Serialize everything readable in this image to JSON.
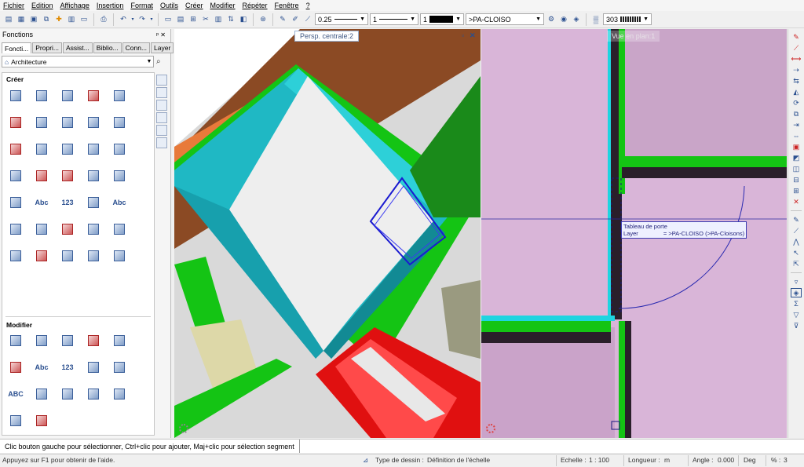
{
  "menu": [
    "Fichier",
    "Edition",
    "Affichage",
    "Insertion",
    "Format",
    "Outils",
    "Créer",
    "Modifier",
    "Répéter",
    "Fenêtre",
    "?"
  ],
  "toolbar": {
    "pen_thickness": "0.25",
    "line_type": "1",
    "color_number": "1",
    "layer": ">PA-CLOISO",
    "style_number": "303"
  },
  "panel": {
    "title": "Fonctions",
    "pin": "ᵖ ✕",
    "tabs": [
      "Foncti...",
      "Propri...",
      "Assist...",
      "Biblio...",
      "Conn...",
      "Layer"
    ],
    "library": "Architecture",
    "section_create": "Créer",
    "section_modify": "Modifier",
    "create_icon_labels": [
      "",
      "",
      "",
      "",
      "",
      "",
      "",
      "",
      "",
      "",
      "",
      "",
      "",
      "",
      "",
      "",
      "",
      "",
      "",
      "",
      "",
      "Abc",
      "123",
      "",
      "Abc",
      "",
      "",
      "",
      "",
      "",
      "",
      "",
      "",
      "",
      ""
    ],
    "modify_icon_labels": [
      "",
      "",
      "",
      "",
      "",
      "",
      "Abc",
      "123",
      "",
      "",
      "ABC",
      "",
      "",
      "",
      "",
      "",
      ""
    ]
  },
  "viewports": {
    "perspective_title": "Persp. centrale:2",
    "plan_title": "Vue en plan:1",
    "tooltip_line1": "Tableau de porte",
    "tooltip_line2_label": "Layer",
    "tooltip_line2_value": "= >PA-CLOISO (>PA-Cloisons)"
  },
  "hint": "Clic bouton gauche pour sélectionner, Ctrl+clic pour ajouter, Maj+clic pour sélection segment",
  "status": {
    "help": "Appuyez sur F1 pour obtenir de l'aide.",
    "drawing_type_label": "Type de dessin :",
    "drawing_type_value": "Définition de l'échelle",
    "scale_label": "Echelle :",
    "scale_value": "1 : 100",
    "length_label": "Longueur :",
    "length_value": "m",
    "angle_label": "Angle :",
    "angle_value": "0.000",
    "angle_unit": "Deg",
    "percent_label": "% :",
    "percent_value": "3"
  },
  "colors": {
    "wall_cyan": "#1fb8c4",
    "wall_green": "#14c414",
    "wall_red": "#e01010",
    "plan_background": "#d9b5d8",
    "selection_blue": "#1a1ad0"
  }
}
